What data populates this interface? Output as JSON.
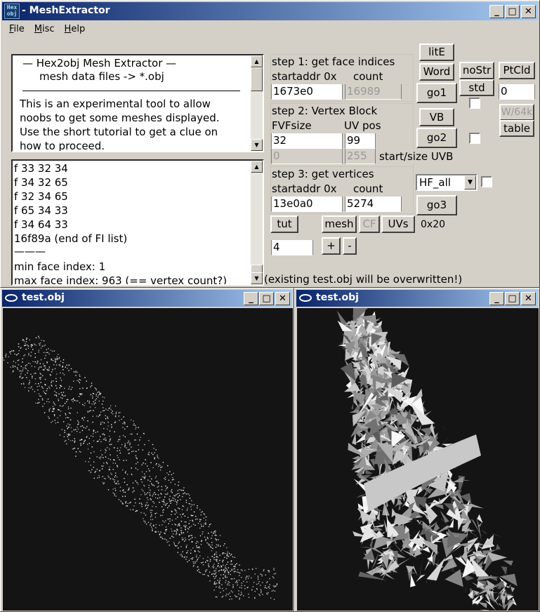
{
  "main_window": {
    "title": "- MeshExtractor",
    "icon_text": "Hex obj",
    "buttons": {
      "minimize": "_",
      "maximize": "□",
      "close": "✕"
    }
  },
  "menu": [
    "File",
    "Misc",
    "Help"
  ],
  "intro": {
    "heading": "—   Hex2obj Mesh Extractor   —",
    "subheading": "mesh data files -> *.obj",
    "divider": "——————————————————",
    "body": [
      "This is an experimental tool to allow",
      "noobs to get some meshes displayed.",
      "Use the short tutorial to get a clue on",
      "how to proceed."
    ]
  },
  "log": {
    "lines": [
      "f  33 32 34",
      "f  34 32 65",
      "f  32 34 65",
      "f  65 34 33",
      "f  34 64 33",
      "16f89a (end of FI list)",
      "———",
      "min face index: 1",
      "max face index: 963 (== vertex count?)"
    ]
  },
  "step1": {
    "title": "step 1: get face indices",
    "startaddr_label": "startaddr 0x",
    "count_label": "count",
    "startaddr_value": "1673e0",
    "count_value": "16989"
  },
  "step2": {
    "title": "step 2: Vertex Block",
    "fvf_label": "FVFsize",
    "uv_label": "UV pos",
    "fvf_value": "32",
    "uv_value": "99",
    "start_value": "0",
    "size_value": "255",
    "uvb_label": "start/size UVB"
  },
  "step3": {
    "title": "step 3: get vertices",
    "startaddr_label": "startaddr 0x",
    "count_label": "count",
    "startaddr_value": "13e0a0",
    "count_value": "5274"
  },
  "buttons": {
    "lite": "litE",
    "word": "Word",
    "nostr": "noStr",
    "ptcld": "PtCld",
    "go1": "go1",
    "std": "std",
    "w64k": "W/64k",
    "table": "table",
    "vb": "VB",
    "go2": "go2",
    "go3": "go3",
    "tut": "tut",
    "mesh": "mesh",
    "cf": "CF",
    "uvs": "UVs",
    "plus": "+",
    "minus": "-"
  },
  "fields": {
    "ptcld_value": "0",
    "step_value": "4"
  },
  "select": {
    "value": "HF_all"
  },
  "hex_label": "0x20",
  "status": "(existing test.obj will be overwritten!)",
  "viewer_left": {
    "title": "test.obj"
  },
  "viewer_right": {
    "title": "test.obj"
  },
  "colors": {
    "title_start": "#0a246a",
    "title_end": "#a6caf0",
    "face": "#d4d0c8",
    "viewport": "#141414"
  }
}
